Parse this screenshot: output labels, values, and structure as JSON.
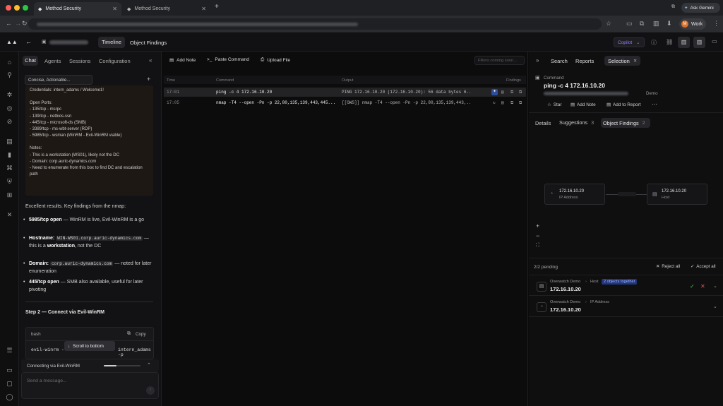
{
  "browser": {
    "tabs": [
      {
        "title": "Method Security"
      },
      {
        "title": "Method Security"
      }
    ],
    "profile": "Work",
    "profile_initial": "M",
    "gemini": "Ask Gemini"
  },
  "appbar": {
    "timeline": "Timeline",
    "object_findings": "Object Findings",
    "copilot": "Copilot"
  },
  "chat": {
    "tabs": [
      "Chat",
      "Agents",
      "Sessions",
      "Configuration"
    ],
    "mode_select": "Concise, Actionable...",
    "card": {
      "lines": [
        "Credentials: intern_adams / Welcome1!",
        "",
        "Open Ports:",
        "- 135/tcp - msrpc",
        "- 139/tcp - netbios-ssn",
        "- 445/tcp - microsoft-ds (SMB)",
        "- 3389/tcp - ms-wbt-server (RDP)",
        "- 5985/tcp - wsman (WinRM - Evil-WinRM viable)",
        "",
        "Notes:",
        "- This is a workstation (WS01), likely not the DC",
        "- Domain: corp.auric-dynamics.com",
        "- Need to enumerate from this box to find DC and escalation path"
      ]
    },
    "intro": "Excellent results. Key findings from the nmap:",
    "bullets": [
      {
        "bold": "5985/tcp open",
        "text": " — WinRM is live, Evil-WinRM is a go"
      },
      {
        "bold": "Hostname:",
        "code": "WIN-WS01.corp.auric-dynamics.com",
        "text": " — this is a ",
        "bold2": "workstation",
        "text2": ", not the DC"
      },
      {
        "bold": "Domain:",
        "code": "corp.auric-dynamics.com",
        "text": " — noted for later enumeration"
      },
      {
        "bold": "445/tcp open",
        "text": " — SMB also available, useful for later pivoting"
      }
    ],
    "step": "Step 2 — Connect via Evil-WinRM",
    "code_lang": "bash",
    "copy": "Copy",
    "code_left": "evil-winrm -",
    "code_right": "intern_adams -p",
    "scroll": "Scroll to bottom",
    "status": "Connecting via Evil-WinRM",
    "placeholder": "Send a message..."
  },
  "timeline": {
    "toolbar": [
      "Add Note",
      "Paste Command",
      "Upload File"
    ],
    "filter_placeholder": "Filters coming soon...",
    "columns": [
      "Time",
      "Command",
      "Output",
      "Findings"
    ],
    "rows": [
      {
        "time": "17:01",
        "command": "ping -c 4 172.16.10.20",
        "output": "PING 172.16.10.20 (172.16.10.20): 56 data bytes 6...",
        "selected": true
      },
      {
        "time": "17:05",
        "command": "nmap -T4 --open -Pn -p 22,80,135,139,443,445...",
        "output": "[[OWS]] nmap -T4 --open -Pn -p 22,80,135,139,443,...",
        "selected": false
      }
    ]
  },
  "detail": {
    "tabs": [
      "Search",
      "Reports",
      "Selection"
    ],
    "kind": "Command",
    "command": "ping -c 4 172.16.10.20",
    "workspace": "Demo",
    "actions": [
      "Star",
      "Add Note",
      "Add to Report"
    ],
    "subtabs": [
      {
        "label": "Details"
      },
      {
        "label": "Suggestions",
        "count": "3"
      },
      {
        "label": "Object Findings",
        "count": "2"
      }
    ],
    "graph": {
      "nodes": [
        {
          "title": "172.16.10.20",
          "type": "IP Address"
        },
        {
          "title": "172.16.10.20",
          "type": "Host"
        }
      ]
    },
    "pending_label": "2/2 pending",
    "reject_all": "Reject all",
    "accept_all": "Accept all",
    "pending": [
      {
        "crumb": [
          "Overwatch Demo",
          "Host"
        ],
        "tag": "2 objects together",
        "value": "172.16.10.20"
      },
      {
        "crumb": [
          "Overwatch Demo",
          "IP Address"
        ],
        "value": "172.16.10.20"
      }
    ]
  },
  "colors": {
    "accent": "#3d6fe0",
    "copilot": "#7f5fd6",
    "profile": "#d9742f"
  }
}
